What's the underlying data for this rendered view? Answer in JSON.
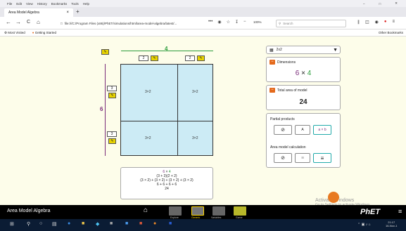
{
  "menubar": {
    "items": [
      "File",
      "Edit",
      "View",
      "History",
      "Bookmarks",
      "Tools",
      "Help"
    ]
  },
  "window": {
    "minimize": "–",
    "maximize": "□",
    "close": "✕"
  },
  "tab": {
    "title": "Area Model Algebra",
    "close": "×",
    "new": "+"
  },
  "nav": {
    "back": "←",
    "forward": "→",
    "reload": "C",
    "home": "⌂",
    "url": "file:///C:/Program Files (x86)/PhET/simulations/html/area-model-algebra/latest/...",
    "zoom": "100%",
    "search_placeholder": "Search",
    "more": "•••"
  },
  "bookmarks": {
    "most_visited": "Most Visited",
    "getting_started": "Getting Started",
    "other": "Other Bookmarks"
  },
  "model": {
    "width_total": "4",
    "height_total": "6",
    "width_parts": [
      "2",
      "2"
    ],
    "height_parts": [
      "3",
      "3"
    ],
    "cells": [
      "3×2",
      "3×2",
      "3×2",
      "3×2"
    ],
    "pencil": "✎"
  },
  "calculation": {
    "line1_a": "6",
    "line1_op": " × ",
    "line1_b": "4",
    "line2": "(3 + 3)(2 + 2)",
    "line3": "(3 × 2) + (3 × 2) + (3 × 2) + (3 × 2)",
    "line4": "6 + 6 + 6 + 6",
    "line5": "24"
  },
  "panel": {
    "grid_select": "2x2",
    "grid_arrow": "▼",
    "dimensions_title": "Dimensions",
    "dim_a": "6",
    "dim_op": "×",
    "dim_b": "4",
    "total_title": "Total area of model",
    "total_value": "24",
    "partial_title": "Partial products",
    "partial_btn_b": "A",
    "partial_btn_c": "a × b",
    "calc_title": "Area model calculation",
    "minus": "−"
  },
  "simbar": {
    "title": "Area Model Algebra",
    "home": "⌂",
    "screens": [
      "Explore",
      "Generic",
      "Variables",
      "Game"
    ],
    "brand": "PhET",
    "menu": "≡"
  },
  "watermark": {
    "line1": "Activate Windows",
    "line2": "Go to Settings to activate Windows."
  },
  "taskbar": {
    "time": "21:17",
    "date": "16-Nov-1"
  },
  "colors": {
    "accent_orange": "#e46a1c",
    "width_green": "#2e9e3d",
    "height_purple": "#7a2c7a",
    "grid_fill": "#ccebf5",
    "sim_bg": "#fdfdea"
  }
}
